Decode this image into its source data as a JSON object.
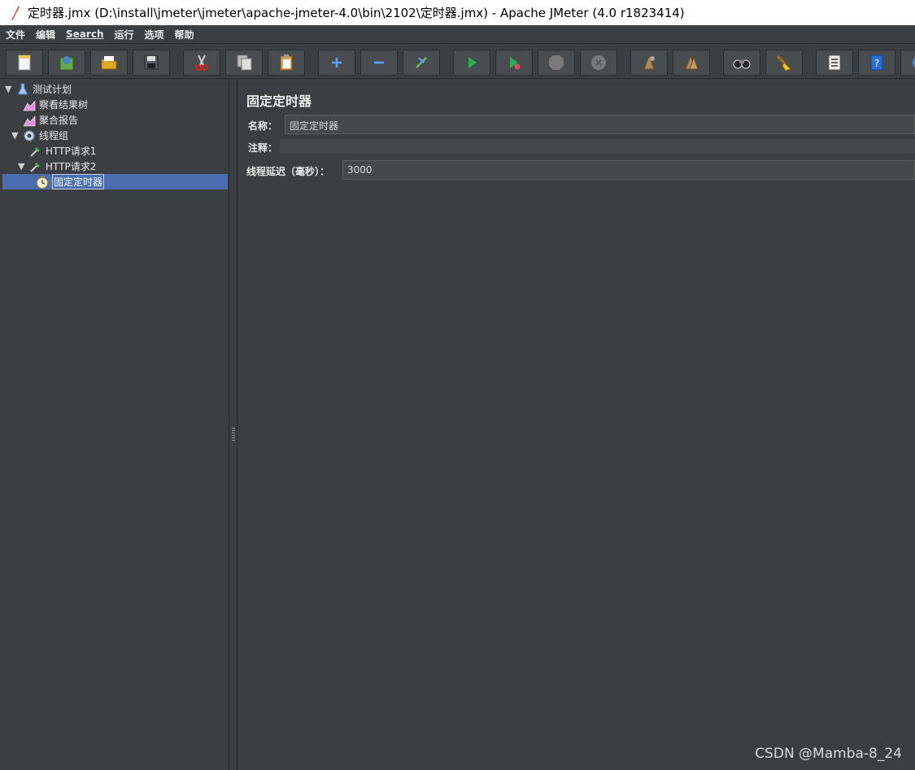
{
  "window": {
    "title": "定时器.jmx (D:\\install\\jmeter\\jmeter\\apache-jmeter-4.0\\bin\\2102\\定时器.jmx) - Apache JMeter (4.0 r1823414)"
  },
  "menu": {
    "file": "文件",
    "edit": "编辑",
    "search": "Search",
    "run": "运行",
    "options": "选项",
    "help": "帮助"
  },
  "toolbar": {
    "icons": [
      "new-icon",
      "templates-icon",
      "open-icon",
      "save-icon",
      "cut-icon",
      "copy-icon",
      "paste-icon",
      "expand-icon",
      "collapse-icon",
      "toggle-icon",
      "start-icon",
      "start-no-pause-icon",
      "stop-icon",
      "shutdown-icon",
      "clear-icon",
      "clear-all-icon",
      "search-icon",
      "reset-search-icon",
      "function-helper-icon",
      "help-icon",
      "remote-icon"
    ]
  },
  "tree": {
    "items": [
      {
        "label": "测试计划",
        "icon": "flask-icon",
        "expanded": true
      },
      {
        "label": "察看结果树",
        "icon": "graph-icon"
      },
      {
        "label": "聚合报告",
        "icon": "graph-icon"
      },
      {
        "label": "线程组",
        "icon": "gear-icon",
        "expanded": true
      },
      {
        "label": "HTTP请求1",
        "icon": "pipette-icon"
      },
      {
        "label": "HTTP请求2",
        "icon": "pipette-icon",
        "expanded": true
      },
      {
        "label": "固定定时器",
        "icon": "timer-icon",
        "selected": true
      }
    ]
  },
  "panel": {
    "title": "固定定时器",
    "name_label": "名称：",
    "name_value": "固定定时器",
    "comment_label": "注释：",
    "delay_label": "线程延迟（毫秒）：",
    "delay_value": "3000"
  },
  "watermark": "CSDN @Mamba-8_24",
  "colors": {
    "background": "#3c3f41",
    "selection": "#4b6eaf",
    "input": "#45494a"
  }
}
